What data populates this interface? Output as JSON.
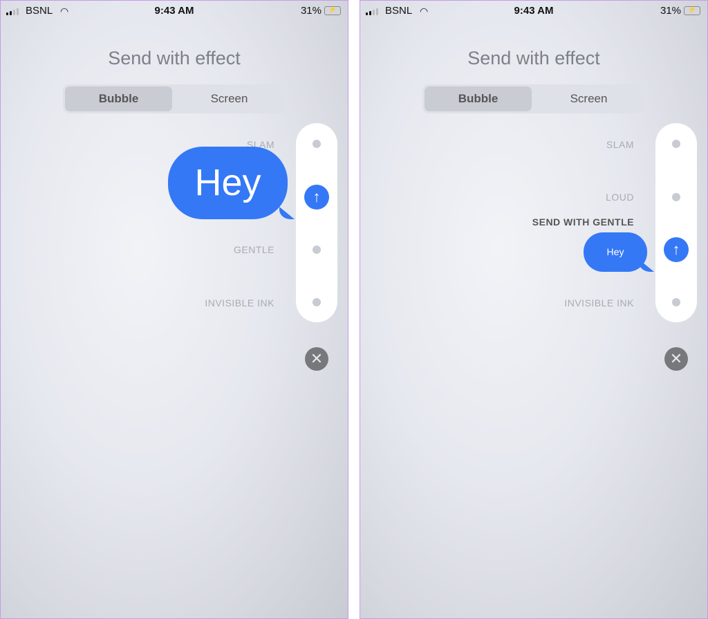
{
  "status": {
    "carrier": "BSNL",
    "time": "9:43 AM",
    "battery": "31%"
  },
  "screens": [
    {
      "title": "Send with effect",
      "tabs": [
        {
          "label": "Bubble",
          "selected": true
        },
        {
          "label": "Screen",
          "selected": false
        }
      ],
      "effects": {
        "slam": "SLAM",
        "gentle": "GENTLE",
        "invisible": "INVISIBLE INK"
      },
      "message": "Hey"
    },
    {
      "title": "Send with effect",
      "tabs": [
        {
          "label": "Bubble",
          "selected": true
        },
        {
          "label": "Screen",
          "selected": false
        }
      ],
      "effects": {
        "slam": "SLAM",
        "loud": "LOUD",
        "gentle": "SEND WITH GENTLE",
        "invisible": "INVISIBLE INK"
      },
      "message": "Hey"
    }
  ],
  "colors": {
    "accent": "#3478f6",
    "border": "#c79ae8"
  }
}
